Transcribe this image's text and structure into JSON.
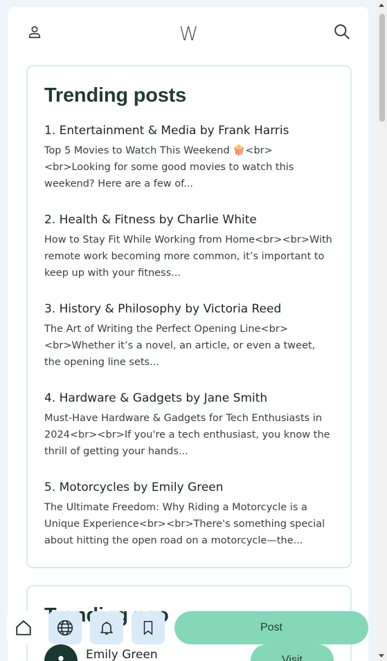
{
  "header": {
    "logo_text": "W",
    "profile_icon": "person-icon",
    "search_icon": "search-icon"
  },
  "trending_posts": {
    "title": "Trending posts",
    "items": [
      {
        "title": "1. Entertainment & Media by Frank Harris",
        "excerpt": "Top 5 Movies to Watch This Weekend 🍿<br><br>Looking for some good movies to watch this weekend? Here are a few of..."
      },
      {
        "title": "2. Health & Fitness by Charlie White",
        "excerpt": "How to Stay Fit While Working from Home<br><br>With remote work becoming more common, it’s important to keep up with your fitness..."
      },
      {
        "title": "3. History & Philosophy by Victoria Reed",
        "excerpt": "The Art of Writing the Perfect Opening Line<br><br>Whether it’s a novel, an article, or even a tweet, the opening line sets..."
      },
      {
        "title": "4. Hardware & Gadgets by Jane Smith",
        "excerpt": "Must-Have Hardware & Gadgets for Tech Enthusiasts in 2024<br><br>If you're a tech enthusiast, you know the thrill of getting your hands..."
      },
      {
        "title": "5. Motorcycles by Emily Green",
        "excerpt": "The Ultimate Freedom: Why Riding a Motorcycle is a Unique Experience<br><br>There's something special about hitting the open road on a motorcycle—the..."
      }
    ]
  },
  "trending_people": {
    "title": "Trending peo",
    "person_name": "Emily Green",
    "visit_label": "Visit"
  },
  "bottom_bar": {
    "home_icon": "home-icon",
    "globe_icon": "globe-icon",
    "bell_icon": "bell-icon",
    "bookmark_icon": "bookmark-icon",
    "post_label": "Post"
  },
  "colors": {
    "accent": "#84d8b8",
    "title": "#1f3b36",
    "card_border": "#d6ece6",
    "nav_tint": "#d9ebf8"
  }
}
